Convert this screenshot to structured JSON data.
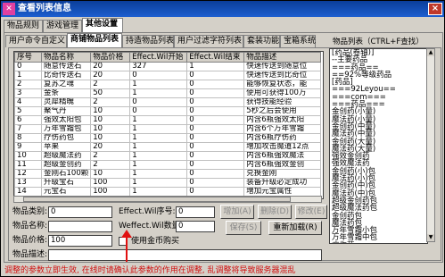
{
  "window": {
    "title": "查看列表信息",
    "close_label": "×"
  },
  "top_tabs": [
    "物品规则",
    "游戏管理",
    "其他设置"
  ],
  "sub_tabs": [
    "用户命令自定义",
    "商铺物品列表",
    "持造物品列表",
    "用户过滤字符列表",
    "套装功能",
    "宝箱系统"
  ],
  "right_panel": {
    "group_label": "物品列表（CTRL+F查找）",
    "items": [
      "[药品(卷轴)]",
      "--主要药品",
      "===药品==",
      "==92%等级药品",
      "[药品]",
      "===92Leyou==",
      "===com===",
      "===药品===",
      "金创药(小量)",
      "魔法药(小量)",
      "金创药(中量)",
      "魔法药(中量)",
      "金创药(大量)",
      "魔法药(大量)",
      "强效金创药",
      "强效魔法药",
      "金创药(小)包",
      "魔法药(小)包",
      "金创药(中)包",
      "魔法药(中)包",
      "超级金创药包",
      "超级魔法药包",
      "金创药包",
      "魔法药包",
      "万年雪霜小包",
      "万年雪霜中包",
      "疗伤药",
      "疗伤药中包"
    ]
  },
  "table": {
    "columns": [
      "序号",
      "物品名称",
      "物品价格",
      "Effect.Wil开始",
      "Effect.Wil结束",
      "物品描述"
    ],
    "rows": [
      [
        "0",
        "随意传送石",
        "20",
        "327",
        "1",
        "快速传送到随意位"
      ],
      [
        "1",
        "比奇传送石",
        "20",
        "0",
        "0",
        "快速传送到比奇位"
      ],
      [
        "2",
        "复苏之魂",
        "2",
        "1",
        "0",
        "能够恢复状态，能"
      ],
      [
        "3",
        "金条",
        "50",
        "1",
        "0",
        "使用可获得100万"
      ],
      [
        "4",
        "灵犀精魄",
        "2",
        "0",
        "0",
        "获得技能经验"
      ],
      [
        "5",
        "聚气丹",
        "10",
        "0",
        "0",
        "5秒之后会使用"
      ],
      [
        "6",
        "强效太阳包",
        "10",
        "1",
        "0",
        "内含6瓶强效太阳"
      ],
      [
        "7",
        "万年雪霜包",
        "10",
        "1",
        "0",
        "内含6个万年雪霜"
      ],
      [
        "8",
        "疗伤药包",
        "10",
        "1",
        "0",
        "内含6瓶疗伤药"
      ],
      [
        "9",
        "苹果",
        "20",
        "1",
        "0",
        "增加攻击魔道12点"
      ],
      [
        "10",
        "超级魔法药",
        "2",
        "1",
        "0",
        "内含6瓶强效魔法"
      ],
      [
        "11",
        "超级金创药",
        "2",
        "1",
        "0",
        "内含6瓶强效金创"
      ],
      [
        "12",
        "金刚石100颗",
        "10",
        "1",
        "0",
        "兑换金刚"
      ],
      [
        "13",
        "升级宝石",
        "100",
        "1",
        "0",
        "装备升级必定成功"
      ],
      [
        "14",
        "元宝石",
        "100",
        "1",
        "0",
        "增加元宝属性"
      ],
      [
        "15",
        "魔力精灵",
        "100",
        "0",
        "1",
        "用于增加魔力数值"
      ]
    ]
  },
  "form": {
    "type_label": "物品类别:",
    "type_value": "0",
    "name_label": "物品名称:",
    "name_value": "",
    "price_label": "物品价格:",
    "price_value": "100",
    "desc_label": "物品描述:",
    "desc_value": "",
    "eff_seq_label": "Effect.Wil序号:",
    "eff_seq_value": "0",
    "eff_qty_label": "Weffect.Wil数量:",
    "eff_qty_value": "0",
    "gold_checkbox_label": "使用金币购买"
  },
  "buttons": {
    "add": "增加(A)",
    "delete": "删除(D)",
    "modify": "修改(E)",
    "save": "保存(S)",
    "reload": "重新加载(R)"
  },
  "annotation": "调整的参数立即生效, 在线时请确认此参数的作用在调整, 乱调整将导致服务器混乱"
}
